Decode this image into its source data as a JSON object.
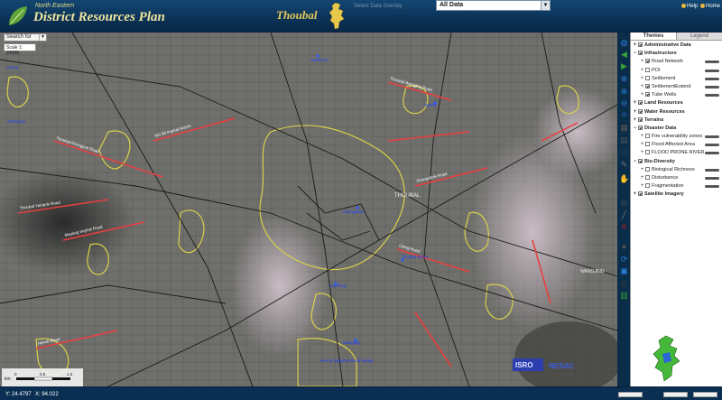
{
  "header": {
    "brand_small": "North Eastern",
    "brand_big": "District Resources Plan",
    "district": "Thoubal",
    "data_label": "Select Data Overlay",
    "data_select_value": "All Data",
    "help": "Help",
    "home": "Home"
  },
  "map": {
    "search_label": "Search for",
    "scale_label": "Scale 1:",
    "scale_value": "34990",
    "scalebar": {
      "unit": "km",
      "ticks": [
        "0",
        "0.5",
        "1.0"
      ]
    },
    "town_label": "THOUBAL",
    "other_town": "WANGJING",
    "logos": [
      "ISRO",
      "NESAC"
    ],
    "roads": [
      {
        "label": "Thoubal Khongjom Road"
      },
      {
        "label": "Thoubal Yairipok Road"
      },
      {
        "label": "Mayang Imphal Road"
      },
      {
        "label": "NH 39 Imphal Moreh"
      },
      {
        "label": "Thoubal Wangjing Road"
      },
      {
        "label": "Khangabok Road"
      },
      {
        "label": "Lilong Road"
      },
      {
        "label": "Heirok Road"
      }
    ],
    "places": [
      "Khekman",
      "Lilong",
      "Athokpam",
      "Tentha",
      "Khangabok",
      "Thoubal Bazar",
      "Kakching",
      "Wangjing",
      "Heirok Tangkhul Road Bridge"
    ]
  },
  "panel": {
    "tabs": [
      "Themes",
      "Legend"
    ],
    "layers": [
      {
        "label": "Administrative Data",
        "group": true,
        "checked": true,
        "expanded": false
      },
      {
        "label": "Infrastructure",
        "group": true,
        "checked": true,
        "expanded": true
      },
      {
        "label": "Road Network",
        "group": false,
        "checked": true,
        "slider": true
      },
      {
        "label": "POI",
        "group": false,
        "checked": false,
        "slider": true
      },
      {
        "label": "Settlement",
        "group": false,
        "checked": false,
        "slider": true
      },
      {
        "label": "SettlementExtend",
        "group": false,
        "checked": true,
        "slider": true
      },
      {
        "label": "Tube Wells",
        "group": false,
        "checked": true,
        "slider": true
      },
      {
        "label": "Land Resources",
        "group": true,
        "checked": true,
        "expanded": false
      },
      {
        "label": "Water Resources",
        "group": true,
        "checked": true,
        "expanded": false
      },
      {
        "label": "Terrains",
        "group": true,
        "checked": true,
        "expanded": false
      },
      {
        "label": "Disaster Data",
        "group": true,
        "checked": true,
        "expanded": true
      },
      {
        "label": "Fire vulnerability zones",
        "group": false,
        "checked": false,
        "slider": true
      },
      {
        "label": "Flood Affected Area",
        "group": false,
        "checked": false,
        "slider": true
      },
      {
        "label": "FLOOD PRONE RIVER",
        "group": false,
        "checked": false,
        "slider": true
      },
      {
        "label": "Bio-Diversity",
        "group": true,
        "checked": true,
        "expanded": true
      },
      {
        "label": "Biological Richness",
        "group": false,
        "checked": false,
        "slider": true
      },
      {
        "label": "Disturbance",
        "group": false,
        "checked": false,
        "slider": true
      },
      {
        "label": "Fragmentation",
        "group": false,
        "checked": false,
        "slider": true
      },
      {
        "label": "Satellite Imagery",
        "group": true,
        "checked": true,
        "expanded": false
      }
    ]
  },
  "footer": {
    "y": "Y: 24.4797",
    "x": "X: 94.022"
  },
  "colors": {
    "header_bg": "#0b2f52",
    "road": "#e84040",
    "settlement": "#d9d14a",
    "place_label": "#1c3cff"
  }
}
